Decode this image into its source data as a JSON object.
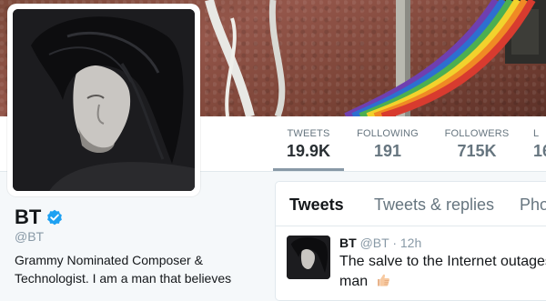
{
  "profile": {
    "name": "BT",
    "handle": "@BT",
    "bio": "Grammy Nominated Composer & Technologist. I am a man that believes"
  },
  "stats": [
    {
      "label": "TWEETS",
      "value": "19.9K",
      "active": true
    },
    {
      "label": "FOLLOWING",
      "value": "191",
      "active": false
    },
    {
      "label": "FOLLOWERS",
      "value": "715K",
      "active": false
    },
    {
      "label": "L",
      "value": "16",
      "active": false
    }
  ],
  "timeline": {
    "tabs": [
      "Tweets",
      "Tweets & replies",
      "Pho"
    ],
    "tweet": {
      "author": "BT",
      "handle": "@BT",
      "separator": "·",
      "time": "12h",
      "text": "The salve to the Internet outages man"
    }
  },
  "icons": {
    "verified": "verified-badge-icon",
    "thumb": "thumbs-up-emoji-icon"
  },
  "colors": {
    "verified_blue": "#1da1f2",
    "accent_grey": "#8899a6",
    "text_dark": "#14171a"
  }
}
